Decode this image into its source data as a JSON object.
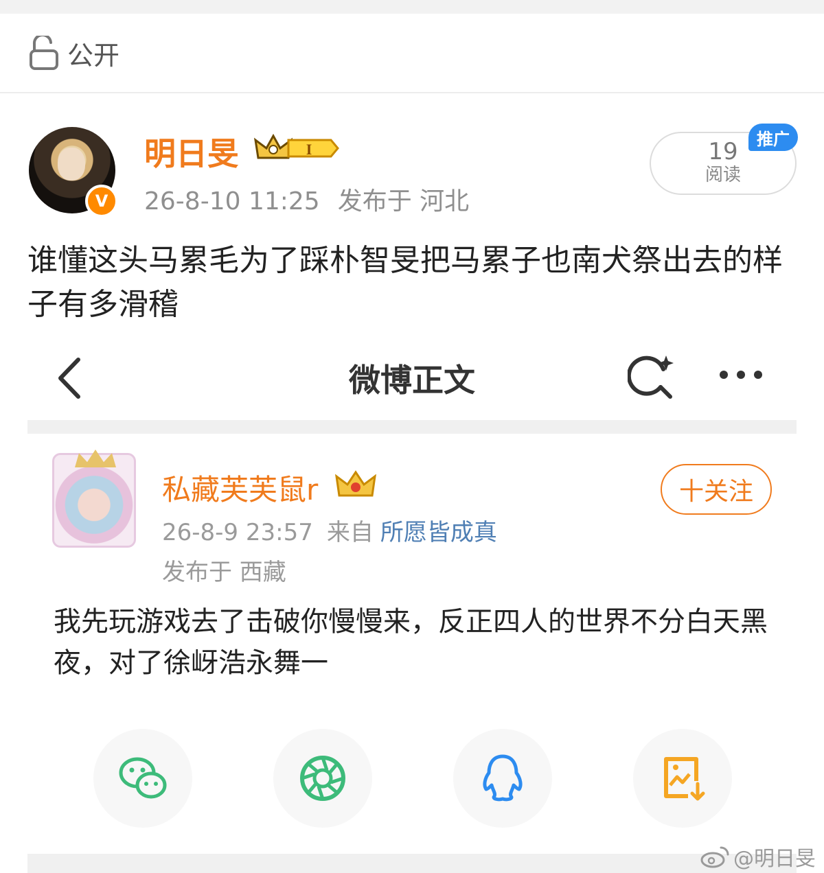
{
  "privacy": {
    "label": "公开"
  },
  "post": {
    "author": "明日旻",
    "level_badge": "I",
    "time": "26-8-10 11:25",
    "location": "发布于 河北",
    "read_count": "19",
    "read_label": "阅读",
    "promo_label": "推广",
    "text": "谁懂这头马累毛为了踩朴智旻把马累子也南犬祭出去的样子有多滑稽"
  },
  "embedded": {
    "title": "微博正文",
    "user": "私藏芙芙鼠r",
    "follow_label": "十关注",
    "time": "26-8-9 23:57",
    "source_label": "来自",
    "source": "所愿皆成真",
    "location": "发布于 西藏",
    "text": "我先玩游戏去了击破你慢慢来，反正四人的世界不分白天黑夜，对了徐岈浩永舞一",
    "share_targets": [
      "wechat-icon",
      "moments-icon",
      "qq-icon",
      "save-image-icon"
    ]
  },
  "watermark": {
    "text": "@明日旻"
  },
  "colors": {
    "accent": "#f07b1d",
    "link": "#4f7fb4",
    "promo": "#2d8cf0",
    "wechat": "#3dbb7a",
    "qq": "#2d8cf0",
    "save": "#f5a623"
  }
}
